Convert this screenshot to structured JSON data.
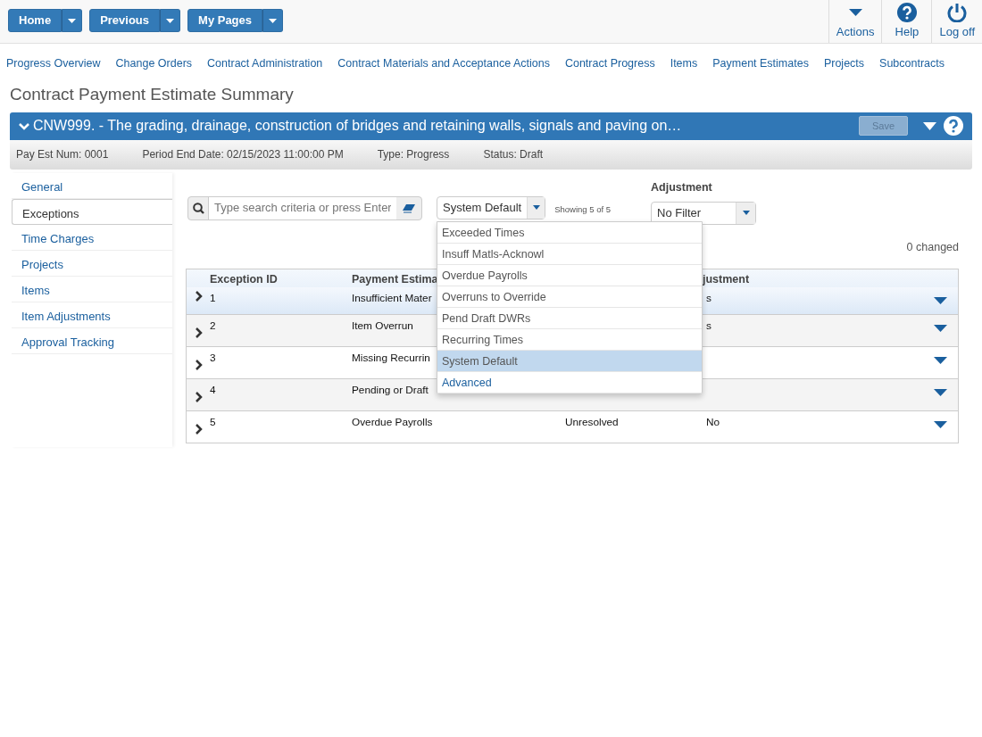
{
  "top_bar": {
    "nav_buttons": [
      "Home",
      "Previous",
      "My Pages"
    ],
    "actions": [
      "Actions",
      "Help",
      "Log off"
    ]
  },
  "menu_links": [
    "Progress Overview",
    "Change Orders",
    "Contract Administration",
    "Contract Materials and Acceptance Actions",
    "Contract Progress",
    "Items",
    "Payment Estimates",
    "Projects",
    "Subcontracts"
  ],
  "page_title": "Contract Payment Estimate Summary",
  "contract_bar": {
    "title": "CNW999. - The grading, drainage, construction of bridges and retaining walls, signals and paving on…",
    "save_button": {
      "label": "Save",
      "disabled": true
    }
  },
  "info_bar": [
    "Pay Est Num: 0001",
    "Period End Date: 02/15/2023 11:00:00 PM",
    "Type: Progress",
    "Status: Draft"
  ],
  "sidebar": {
    "items": [
      {
        "label": "General",
        "selected": false
      },
      {
        "label": "Exceptions",
        "selected": true
      },
      {
        "label": "Time Charges",
        "selected": false
      },
      {
        "label": "Projects",
        "selected": false
      },
      {
        "label": "Items",
        "selected": false
      },
      {
        "label": "Item Adjustments",
        "selected": false
      },
      {
        "label": "Approval Tracking",
        "selected": false
      }
    ]
  },
  "toolbar": {
    "search": {
      "placeholder": "Type search criteria or press Enter"
    },
    "filter_select": {
      "value": "System Default",
      "expanded": true
    },
    "showing": "Showing 5 of 5",
    "adjustment": {
      "label": "Adjustment",
      "value": "No Filter"
    },
    "changed": "0 changed"
  },
  "filter_options": [
    {
      "label": "Exceeded Times",
      "kind": "option",
      "selected": false
    },
    {
      "label": "Insuff Matls-Acknowl",
      "kind": "option",
      "selected": false
    },
    {
      "label": "Overdue Payrolls",
      "kind": "option",
      "selected": false
    },
    {
      "label": "Overruns to Override",
      "kind": "option",
      "selected": false
    },
    {
      "label": "Pend Draft DWRs",
      "kind": "option",
      "selected": false
    },
    {
      "label": "Recurring Times",
      "kind": "option",
      "selected": false
    },
    {
      "label": "System Default",
      "kind": "option",
      "selected": true
    },
    {
      "label": "Advanced",
      "kind": "action",
      "selected": false
    }
  ],
  "table": {
    "columns": {
      "exception_id": "Exception ID",
      "payment_estimate": "Payment Estima",
      "adjustment": "justment"
    },
    "rows": [
      {
        "exception_id": "1",
        "payment_estimate": "Insufficient Mater",
        "adjustment": "s",
        "selected": true
      },
      {
        "exception_id": "2",
        "payment_estimate": "Item Overrun",
        "adjustment": "s",
        "selected": false
      },
      {
        "exception_id": "3",
        "payment_estimate": "Missing Recurrin",
        "selected": false
      },
      {
        "exception_id": "4",
        "payment_estimate": "Pending or Draft",
        "selected": false
      },
      {
        "exception_id": "5",
        "payment_estimate": "Overdue Payrolls",
        "column_3": "Unresolved",
        "adjustment": "No",
        "selected": false
      }
    ]
  }
}
